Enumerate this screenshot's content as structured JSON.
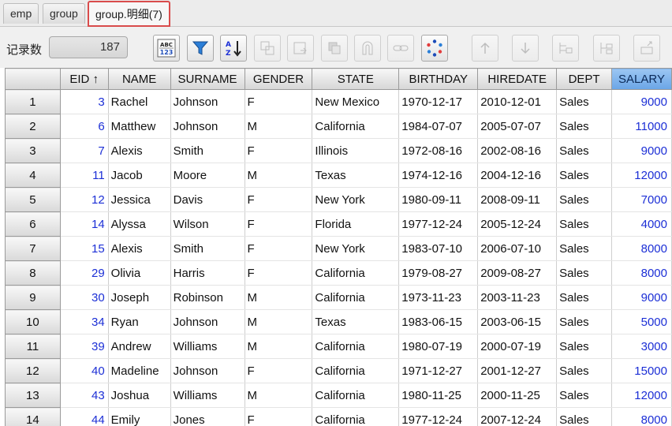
{
  "tabs": [
    {
      "label": "emp",
      "active": false
    },
    {
      "label": "group",
      "active": false
    },
    {
      "label": "group.明细(7)",
      "active": true
    }
  ],
  "toolbar": {
    "record_label": "记录数",
    "record_count": "187",
    "buttons": [
      {
        "name": "abc-123-format-icon",
        "enabled": true
      },
      {
        "name": "filter-icon",
        "enabled": true
      },
      {
        "name": "sort-az-icon",
        "enabled": true
      },
      {
        "name": "copy-rows-icon",
        "enabled": false
      },
      {
        "name": "paste-icon",
        "enabled": false
      },
      {
        "name": "duplicate-icon",
        "enabled": false
      },
      {
        "name": "magnet-icon",
        "enabled": false
      },
      {
        "name": "link-icon",
        "enabled": false
      },
      {
        "name": "refresh-circle-icon",
        "enabled": true
      },
      {
        "name": "arrow-up-icon",
        "enabled": false
      },
      {
        "name": "arrow-down-icon",
        "enabled": false
      },
      {
        "name": "insert-row-icon",
        "enabled": false
      },
      {
        "name": "delete-row-icon",
        "enabled": false
      },
      {
        "name": "move-row-icon",
        "enabled": false
      }
    ]
  },
  "grid": {
    "columns": [
      "EID ↑",
      "NAME",
      "SURNAME",
      "GENDER",
      "STATE",
      "BIRTHDAY",
      "HIREDATE",
      "DEPT",
      "SALARY"
    ],
    "selected_column": "SALARY",
    "rows": [
      {
        "n": "1",
        "eid": "3",
        "name": "Rachel",
        "surname": "Johnson",
        "gender": "F",
        "state": "New Mexico",
        "birthday": "1970-12-17",
        "hiredate": "2010-12-01",
        "dept": "Sales",
        "salary": "9000"
      },
      {
        "n": "2",
        "eid": "6",
        "name": "Matthew",
        "surname": "Johnson",
        "gender": "M",
        "state": "California",
        "birthday": "1984-07-07",
        "hiredate": "2005-07-07",
        "dept": "Sales",
        "salary": "11000"
      },
      {
        "n": "3",
        "eid": "7",
        "name": "Alexis",
        "surname": "Smith",
        "gender": "F",
        "state": "Illinois",
        "birthday": "1972-08-16",
        "hiredate": "2002-08-16",
        "dept": "Sales",
        "salary": "9000"
      },
      {
        "n": "4",
        "eid": "11",
        "name": "Jacob",
        "surname": "Moore",
        "gender": "M",
        "state": "Texas",
        "birthday": "1974-12-16",
        "hiredate": "2004-12-16",
        "dept": "Sales",
        "salary": "12000"
      },
      {
        "n": "5",
        "eid": "12",
        "name": "Jessica",
        "surname": "Davis",
        "gender": "F",
        "state": "New York",
        "birthday": "1980-09-11",
        "hiredate": "2008-09-11",
        "dept": "Sales",
        "salary": "7000"
      },
      {
        "n": "6",
        "eid": "14",
        "name": "Alyssa",
        "surname": "Wilson",
        "gender": "F",
        "state": "Florida",
        "birthday": "1977-12-24",
        "hiredate": "2005-12-24",
        "dept": "Sales",
        "salary": "4000"
      },
      {
        "n": "7",
        "eid": "15",
        "name": "Alexis",
        "surname": "Smith",
        "gender": "F",
        "state": "New York",
        "birthday": "1983-07-10",
        "hiredate": "2006-07-10",
        "dept": "Sales",
        "salary": "8000"
      },
      {
        "n": "8",
        "eid": "29",
        "name": "Olivia",
        "surname": "Harris",
        "gender": "F",
        "state": "California",
        "birthday": "1979-08-27",
        "hiredate": "2009-08-27",
        "dept": "Sales",
        "salary": "8000"
      },
      {
        "n": "9",
        "eid": "30",
        "name": "Joseph",
        "surname": "Robinson",
        "gender": "M",
        "state": "California",
        "birthday": "1973-11-23",
        "hiredate": "2003-11-23",
        "dept": "Sales",
        "salary": "9000"
      },
      {
        "n": "10",
        "eid": "34",
        "name": "Ryan",
        "surname": "Johnson",
        "gender": "M",
        "state": "Texas",
        "birthday": "1983-06-15",
        "hiredate": "2003-06-15",
        "dept": "Sales",
        "salary": "5000"
      },
      {
        "n": "11",
        "eid": "39",
        "name": "Andrew",
        "surname": "Williams",
        "gender": "M",
        "state": "California",
        "birthday": "1980-07-19",
        "hiredate": "2000-07-19",
        "dept": "Sales",
        "salary": "3000"
      },
      {
        "n": "12",
        "eid": "40",
        "name": "Madeline",
        "surname": "Johnson",
        "gender": "F",
        "state": "California",
        "birthday": "1971-12-27",
        "hiredate": "2001-12-27",
        "dept": "Sales",
        "salary": "15000"
      },
      {
        "n": "13",
        "eid": "43",
        "name": "Joshua",
        "surname": "Williams",
        "gender": "M",
        "state": "California",
        "birthday": "1980-11-25",
        "hiredate": "2000-11-25",
        "dept": "Sales",
        "salary": "12000"
      },
      {
        "n": "14",
        "eid": "44",
        "name": "Emily",
        "surname": "Jones",
        "gender": "F",
        "state": "California",
        "birthday": "1977-12-24",
        "hiredate": "2007-12-24",
        "dept": "Sales",
        "salary": "8000"
      }
    ]
  },
  "colors": {
    "active_tab_border": "#d94c4c",
    "number_text": "#1c2fd6",
    "selected_header": "#6aa5e6"
  }
}
